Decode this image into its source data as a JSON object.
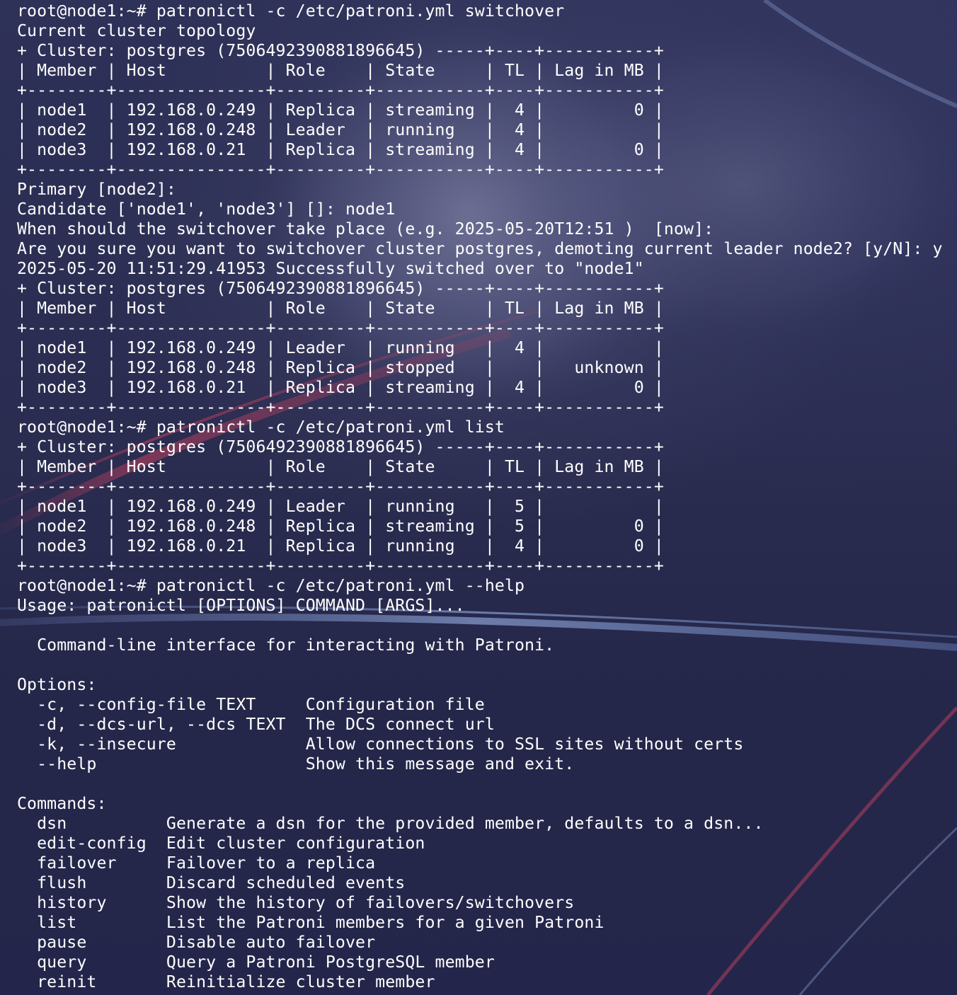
{
  "terminal": {
    "theme": {
      "background": "#27294a",
      "foreground": "#ffffff",
      "accent_red": "#c2415e",
      "accent_blue": "#7d9ad8"
    },
    "lines": [
      "root@node1:~# patronictl -c /etc/patroni.yml switchover",
      "Current cluster topology",
      "+ Cluster: postgres (7506492390881896645) -----+----+-----------+",
      "| Member | Host          | Role    | State     | TL | Lag in MB |",
      "+--------+---------------+---------+-----------+----+-----------+",
      "| node1  | 192.168.0.249 | Replica | streaming |  4 |         0 |",
      "| node2  | 192.168.0.248 | Leader  | running   |  4 |           |",
      "| node3  | 192.168.0.21  | Replica | streaming |  4 |         0 |",
      "+--------+---------------+---------+-----------+----+-----------+",
      "Primary [node2]:",
      "Candidate ['node1', 'node3'] []: node1",
      "When should the switchover take place (e.g. 2025-05-20T12:51 )  [now]:",
      "Are you sure you want to switchover cluster postgres, demoting current leader node2? [y/N]: y",
      "2025-05-20 11:51:29.41953 Successfully switched over to \"node1\"",
      "+ Cluster: postgres (7506492390881896645) -----+----+-----------+",
      "| Member | Host          | Role    | State     | TL | Lag in MB |",
      "+--------+---------------+---------+-----------+----+-----------+",
      "| node1  | 192.168.0.249 | Leader  | running   |  4 |           |",
      "| node2  | 192.168.0.248 | Replica | stopped   |    |   unknown |",
      "| node3  | 192.168.0.21  | Replica | streaming |  4 |         0 |",
      "+--------+---------------+---------+-----------+----+-----------+",
      "root@node1:~# patronictl -c /etc/patroni.yml list",
      "+ Cluster: postgres (7506492390881896645) -----+----+-----------+",
      "| Member | Host          | Role    | State     | TL | Lag in MB |",
      "+--------+---------------+---------+-----------+----+-----------+",
      "| node1  | 192.168.0.249 | Leader  | running   |  5 |           |",
      "| node2  | 192.168.0.248 | Replica | streaming |  5 |         0 |",
      "| node3  | 192.168.0.21  | Replica | running   |  4 |         0 |",
      "+--------+---------------+---------+-----------+----+-----------+",
      "root@node1:~# patronictl -c /etc/patroni.yml --help",
      "Usage: patronictl [OPTIONS] COMMAND [ARGS]...",
      "",
      "  Command-line interface for interacting with Patroni.",
      "",
      "Options:",
      "  -c, --config-file TEXT     Configuration file",
      "  -d, --dcs-url, --dcs TEXT  The DCS connect url",
      "  -k, --insecure             Allow connections to SSL sites without certs",
      "  --help                     Show this message and exit.",
      "",
      "Commands:",
      "  dsn          Generate a dsn for the provided member, defaults to a dsn...",
      "  edit-config  Edit cluster configuration",
      "  failover     Failover to a replica",
      "  flush        Discard scheduled events",
      "  history      Show the history of failovers/switchovers",
      "  list         List the Patroni members for a given Patroni",
      "  pause        Disable auto failover",
      "  query        Query a Patroni PostgreSQL member",
      "  reinit       Reinitialize cluster member"
    ]
  }
}
